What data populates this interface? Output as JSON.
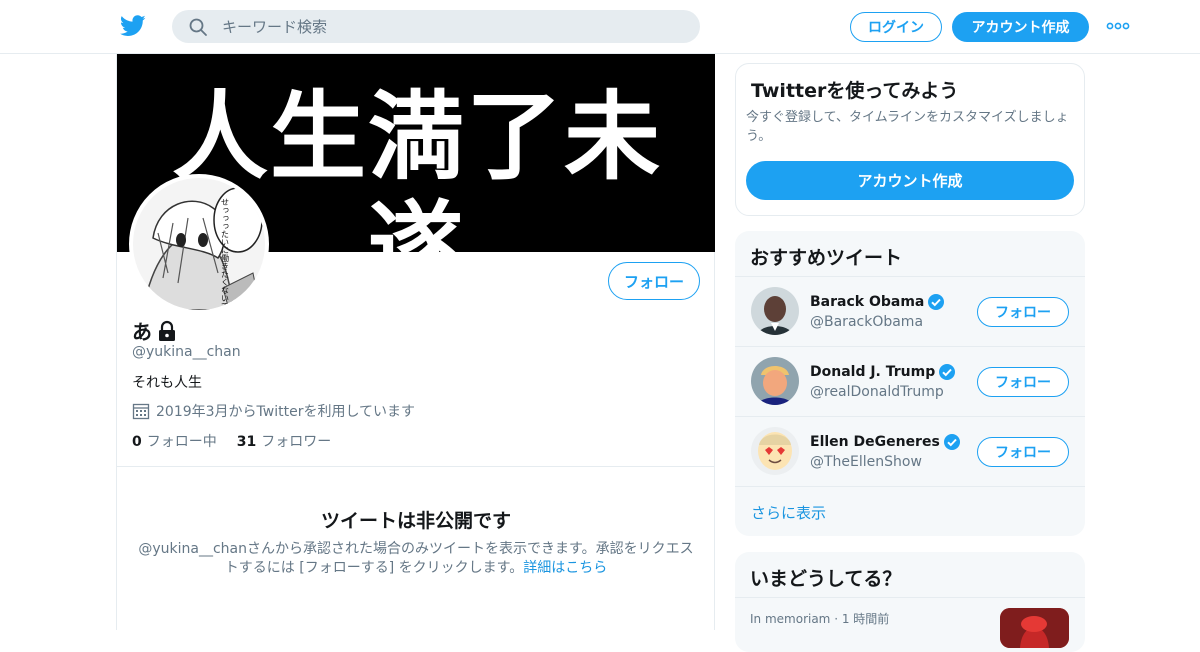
{
  "header": {
    "search_placeholder": "キーワード検索",
    "login_label": "ログイン",
    "signup_label": "アカウント作成",
    "brand_color": "#1da1f2"
  },
  "profile": {
    "banner_text": "人生満了未遂",
    "avatar_speech": "せっっったいに働きたくないでござる",
    "follow_label": "フォロー",
    "name": "あ",
    "handle": "@yukina__chan",
    "bio": "それも人生",
    "joined": "2019年3月からTwitterを利用しています",
    "following_count": "0",
    "following_label": "フォロー中",
    "followers_count": "31",
    "followers_label": "フォロワー",
    "private_title": "ツイートは非公開です",
    "private_desc": "@yukina__chanさんから承認された場合のみツイートを表示できます。承認をリクエストするには [フォローする] をクリックします。",
    "private_link": "詳細はこちら"
  },
  "signup_card": {
    "title": "Twitterを使ってみよう",
    "desc": "今すぐ登録して、タイムラインをカスタマイズしましょう。",
    "cta": "アカウント作成"
  },
  "who_to_follow": {
    "title": "おすすめツイート",
    "follow_label": "フォロー",
    "users": [
      {
        "name": "Barack Obama",
        "handle": "@BarackObama"
      },
      {
        "name": "Donald J. Trump",
        "handle": "@realDonaldTrump"
      },
      {
        "name": "Ellen DeGeneres",
        "handle": "@TheEllenShow"
      }
    ],
    "show_more": "さらに表示"
  },
  "trends": {
    "title": "いまどうしてる？",
    "meta": "In memoriam · 1 時間前"
  }
}
